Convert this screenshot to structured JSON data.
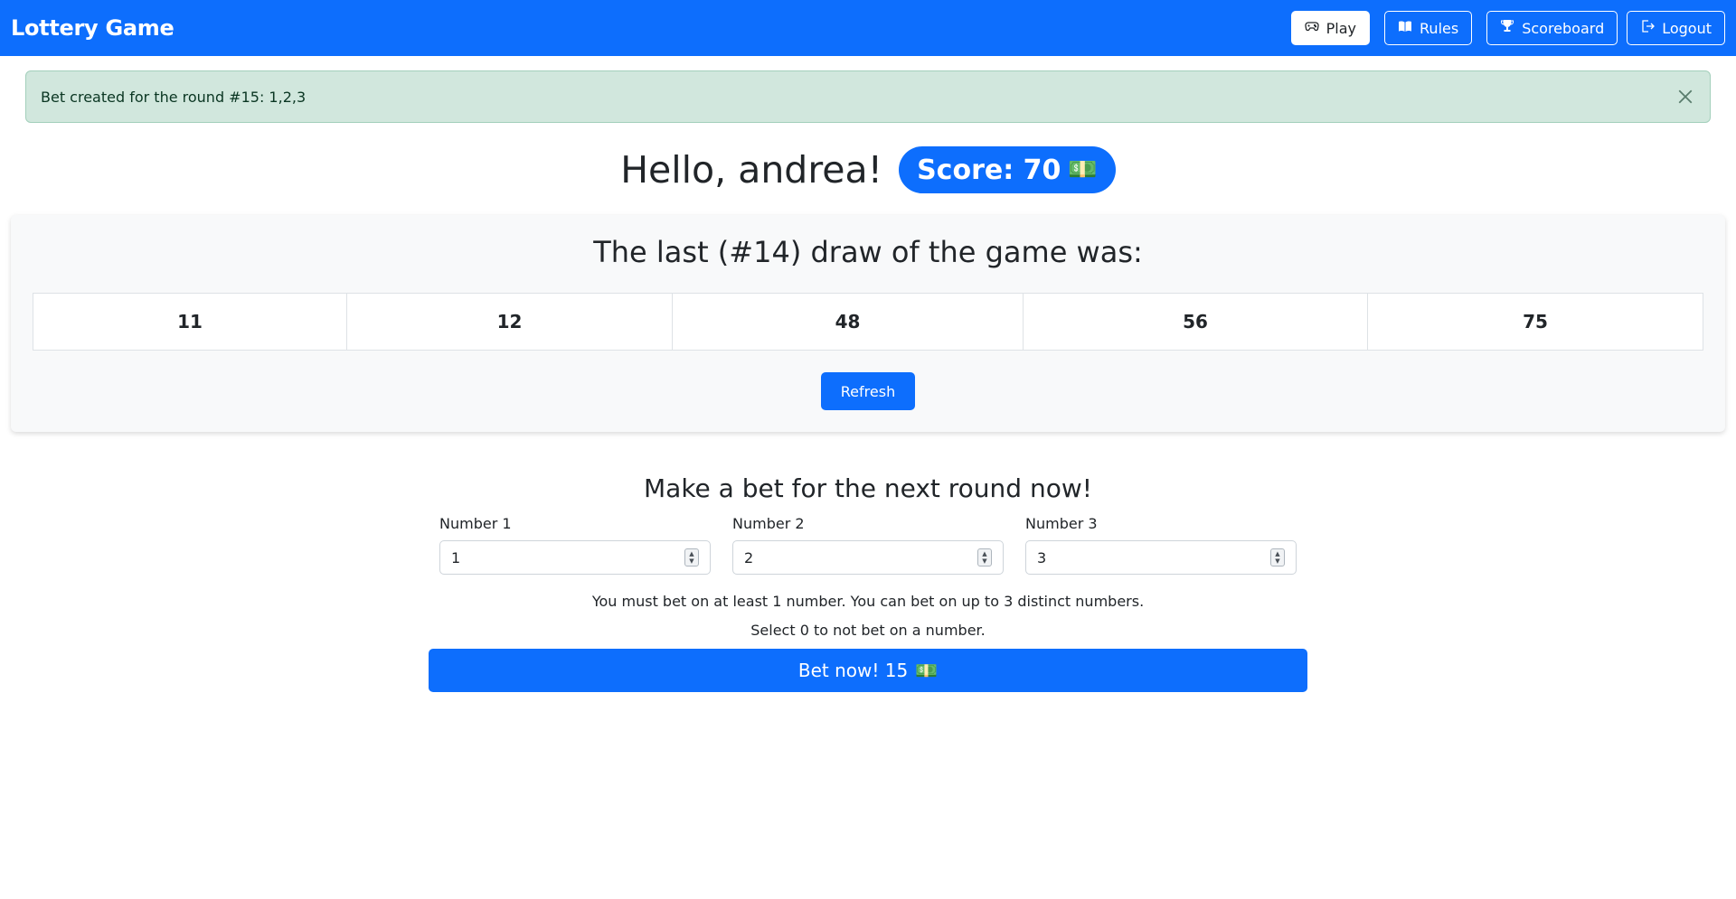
{
  "app": {
    "title": "Lottery Game"
  },
  "nav": {
    "play": "Play",
    "rules": "Rules",
    "scoreboard": "Scoreboard",
    "logout": "Logout"
  },
  "alert": {
    "message": "Bet created for the round #15: 1,2,3"
  },
  "greeting": {
    "text": "Hello, andrea!",
    "score_label": "Score: 70",
    "money_icon": "💵"
  },
  "draw": {
    "title": "The last (#14) draw of the game was:",
    "numbers": [
      "11",
      "12",
      "48",
      "56",
      "75"
    ],
    "refresh_label": "Refresh"
  },
  "bet": {
    "title": "Make a bet for the next round now!",
    "fields": [
      {
        "label": "Number 1",
        "value": "1"
      },
      {
        "label": "Number 2",
        "value": "2"
      },
      {
        "label": "Number 3",
        "value": "3"
      }
    ],
    "help_1": "You must bet on at least 1 number. You can bet on up to 3 distinct numbers.",
    "help_2": "Select 0 to not bet on a number.",
    "button_label": "Bet now! 15",
    "button_icon": "💵"
  },
  "colors": {
    "primary": "#0d6efd",
    "alert_bg": "#d1e7dd",
    "card_bg": "#f8f9fa"
  }
}
